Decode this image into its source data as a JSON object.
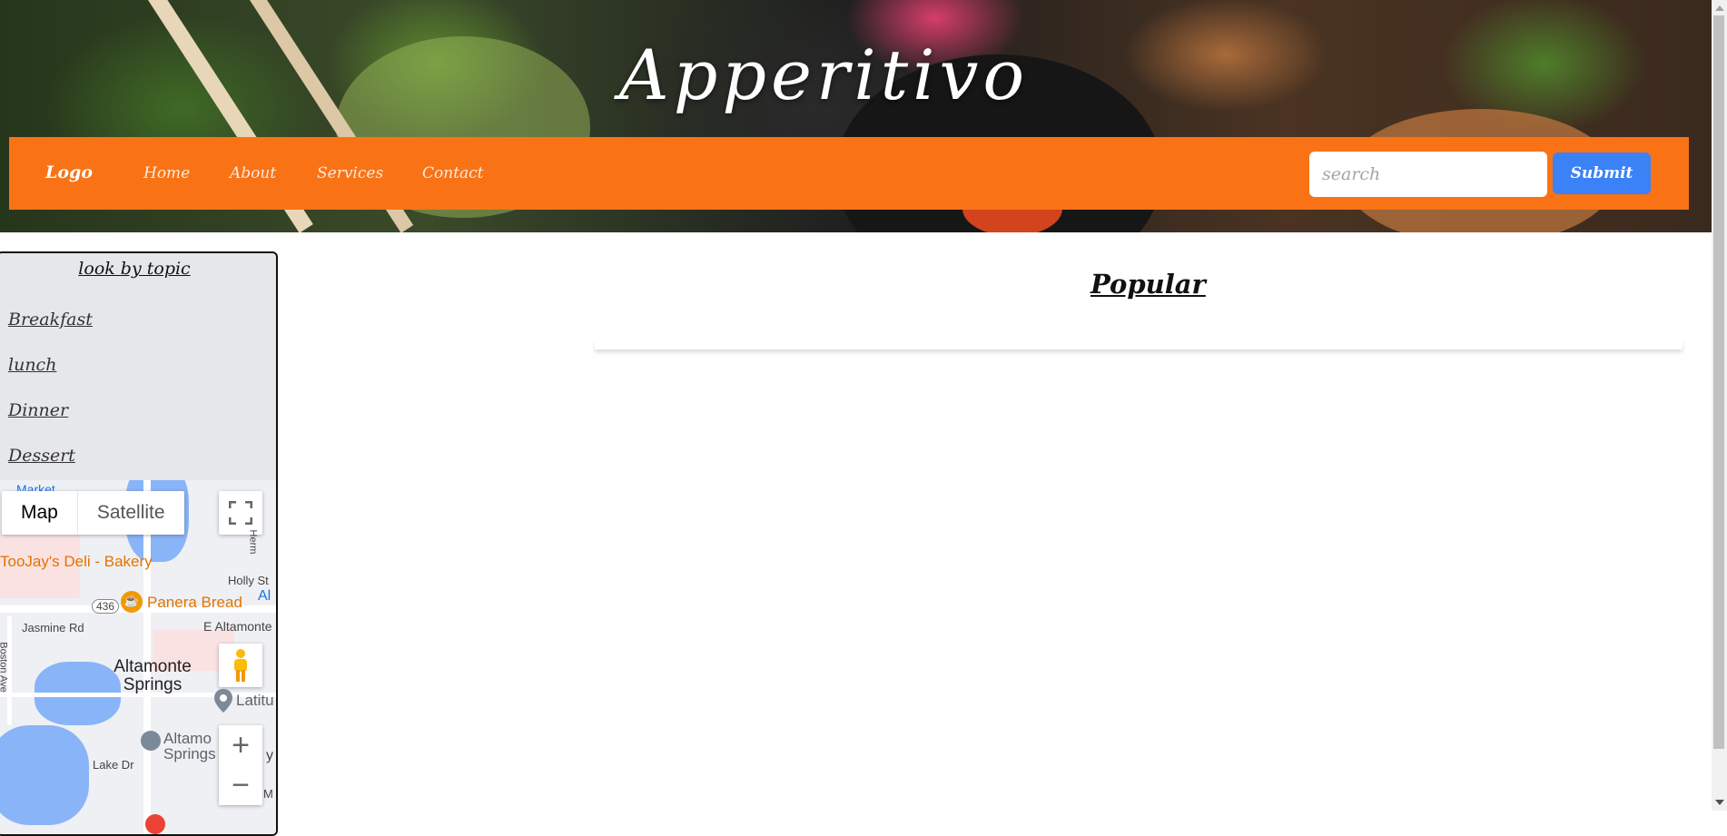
{
  "header": {
    "title": "Apperitivo"
  },
  "navbar": {
    "logo": "Logo",
    "links": [
      "Home",
      "About",
      "Services",
      "Contact"
    ],
    "search_placeholder": "search",
    "search_value": "",
    "submit_label": "Submit"
  },
  "sidebar": {
    "title": "look by topic",
    "topics": [
      "Breakfast",
      "lunch",
      "Dinner",
      "Dessert"
    ]
  },
  "map": {
    "type_options": [
      "Map",
      "Satellite"
    ],
    "selected_type": "Map",
    "labels": {
      "toojays": "TooJay's Deli - Bakery",
      "panera": "Panera Bread",
      "holly_st": "Holly St",
      "jasmine_rd": "Jasmine Rd",
      "e_altamonte": "E Altamonte",
      "altamonte_springs": "Altamonte Springs",
      "altamonte_springs_2": "Altamo Springs",
      "lake_dr": "Lake Dr",
      "boston_ave": "Boston Ave",
      "route_436": "436",
      "herm": "Herm",
      "al": "Al",
      "latitu": "Latitu",
      "m": "M",
      "y": "y",
      "market": "Market"
    },
    "icons": [
      "fullscreen-icon",
      "pegman-icon",
      "zoom-in-icon",
      "zoom-out-icon",
      "cafe-pin-icon",
      "location-pin-icon",
      "library-pin-icon"
    ]
  },
  "main": {
    "popular_title": "Popular"
  },
  "colors": {
    "navbar": "#f97316",
    "submit": "#3b82f6",
    "sidebar_bg": "#e5e7eb"
  }
}
